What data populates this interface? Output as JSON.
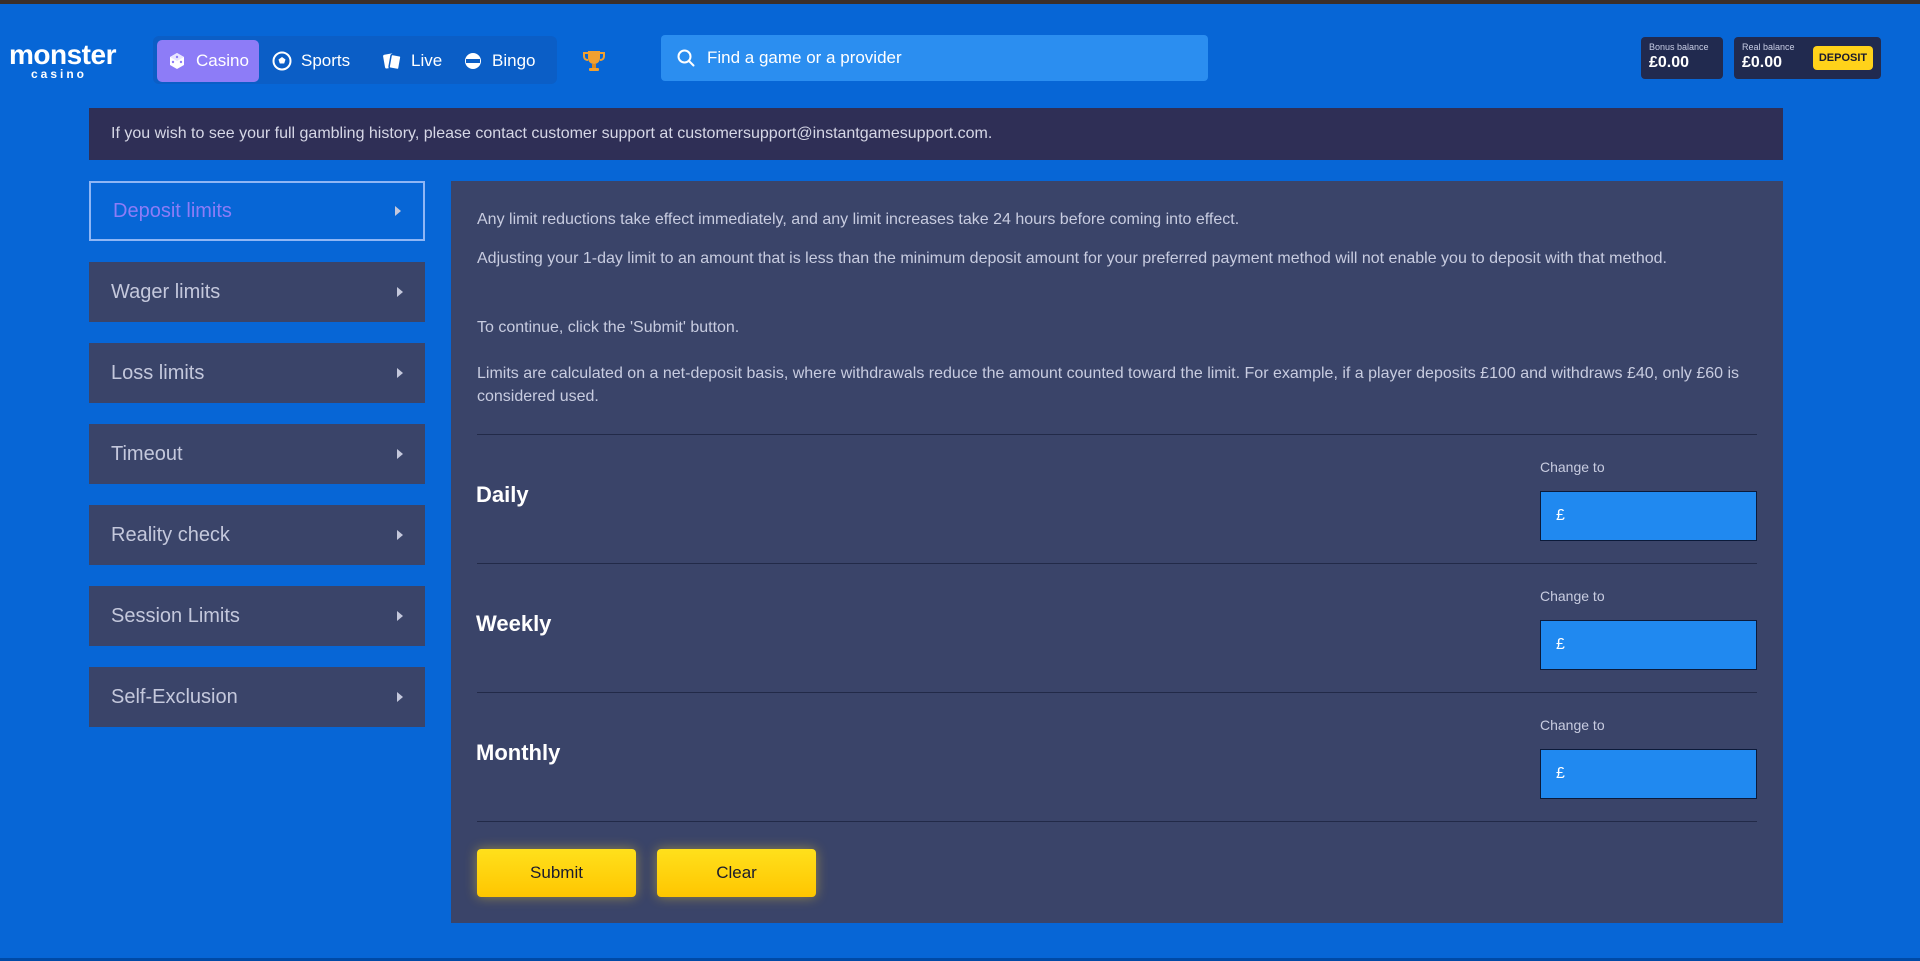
{
  "header": {
    "logo": {
      "main": "monster",
      "sub": "casino"
    },
    "nav": [
      {
        "label": "Casino",
        "icon": "dice-icon",
        "active": true
      },
      {
        "label": "Sports",
        "icon": "soccer-ball-icon",
        "active": false
      },
      {
        "label": "Live",
        "icon": "cards-icon",
        "active": false
      },
      {
        "label": "Bingo",
        "icon": "bingo-ball-icon",
        "active": false
      }
    ],
    "trophy_icon": "trophy-icon",
    "search": {
      "placeholder": "Find a game or a provider",
      "icon": "search-icon"
    },
    "bonus_balance": {
      "label": "Bonus balance",
      "value": "£0.00"
    },
    "real_balance": {
      "label": "Real balance",
      "value": "£0.00"
    },
    "deposit_label": "DEPOSIT"
  },
  "notice": "If you wish to see your full gambling history, please contact customer support at customersupport@instantgamesupport.com.",
  "sidebar": {
    "items": [
      {
        "label": "Deposit limits",
        "active": true
      },
      {
        "label": "Wager limits",
        "active": false
      },
      {
        "label": "Loss limits",
        "active": false
      },
      {
        "label": "Timeout",
        "active": false
      },
      {
        "label": "Reality check",
        "active": false
      },
      {
        "label": "Session Limits",
        "active": false
      },
      {
        "label": "Self-Exclusion",
        "active": false
      }
    ]
  },
  "main": {
    "info": [
      "Any limit reductions take effect immediately, and any limit increases take 24 hours before coming into effect.",
      "Adjusting your 1-day limit to an amount that is less than the minimum deposit amount for your preferred payment method will not enable you to deposit with that method.",
      "To continue, click the 'Submit' button.",
      "Limits are calculated on a net-deposit basis, where withdrawals reduce the amount counted toward the limit. For example, if a player deposits £100 and withdraws £40, only £60 is considered used."
    ],
    "limits": [
      {
        "period": "Daily",
        "change_label": "Change to",
        "currency": "£",
        "value": ""
      },
      {
        "period": "Weekly",
        "change_label": "Change to",
        "currency": "£",
        "value": ""
      },
      {
        "period": "Monthly",
        "change_label": "Change to",
        "currency": "£",
        "value": ""
      }
    ],
    "submit_label": "Submit",
    "clear_label": "Clear"
  },
  "colors": {
    "background": "#0766d6",
    "panel": "#3a4469",
    "accent": "#8d7cf7",
    "button": "#ffd21a"
  }
}
